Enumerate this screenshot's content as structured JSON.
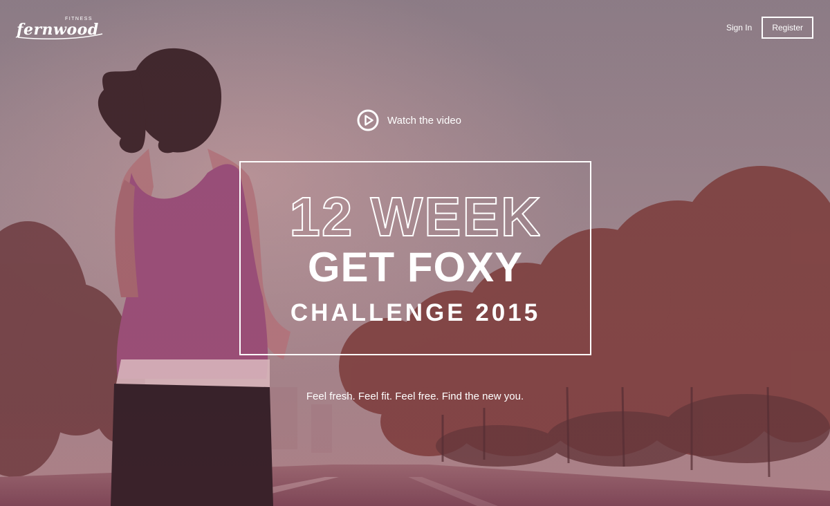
{
  "header": {
    "logo_word": "fernwood",
    "logo_sub": "FITNESS",
    "sign_in_label": "Sign In",
    "register_label": "Register"
  },
  "hero": {
    "watch_label": "Watch the video",
    "title_line1": "12 WEEK",
    "title_line2": "GET FOXY",
    "title_line3": "CHALLENGE 2015",
    "tagline": "Feel fresh. Feel fit. Feel free. Find the new you."
  },
  "icons": {
    "play": "play-circle-icon"
  },
  "colors": {
    "text": "#ffffff",
    "sky": "#93848b",
    "tree": "#7a3e3c",
    "road": "#8a5a66"
  }
}
